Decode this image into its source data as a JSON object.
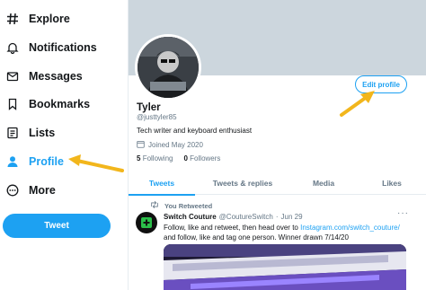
{
  "sidebar": {
    "items": [
      {
        "label": "Explore",
        "icon": "hashtag-icon"
      },
      {
        "label": "Notifications",
        "icon": "bell-icon"
      },
      {
        "label": "Messages",
        "icon": "envelope-icon"
      },
      {
        "label": "Bookmarks",
        "icon": "bookmark-icon"
      },
      {
        "label": "Lists",
        "icon": "list-icon"
      },
      {
        "label": "Profile",
        "icon": "person-icon",
        "active": true
      },
      {
        "label": "More",
        "icon": "more-circle-icon"
      }
    ],
    "tweet_button": "Tweet"
  },
  "profile": {
    "edit_button": "Edit profile",
    "name": "Tyler",
    "handle": "@justtyler85",
    "bio": "Tech writer and keyboard enthusiast",
    "joined": "Joined May 2020",
    "following_count": "5",
    "following_label": "Following",
    "followers_count": "0",
    "followers_label": "Followers"
  },
  "tabs": [
    {
      "label": "Tweets",
      "active": true
    },
    {
      "label": "Tweets & replies"
    },
    {
      "label": "Media"
    },
    {
      "label": "Likes"
    }
  ],
  "tweet": {
    "retweet_label": "You Retweeted",
    "author": "Switch Couture",
    "handle": "@CoutureSwitch",
    "separator": "·",
    "date": "Jun 29",
    "text_before_link": "Follow, like and retweet, then head over to ",
    "link": "Instagram.com/switch_couture/",
    "text_after_link": "and follow, like and tag one person.  Winner drawn 7/14/20",
    "more": "···"
  },
  "colors": {
    "accent": "#1da1f2",
    "annotation_arrow": "#f2b61c",
    "banner": "#ccd6dd"
  }
}
